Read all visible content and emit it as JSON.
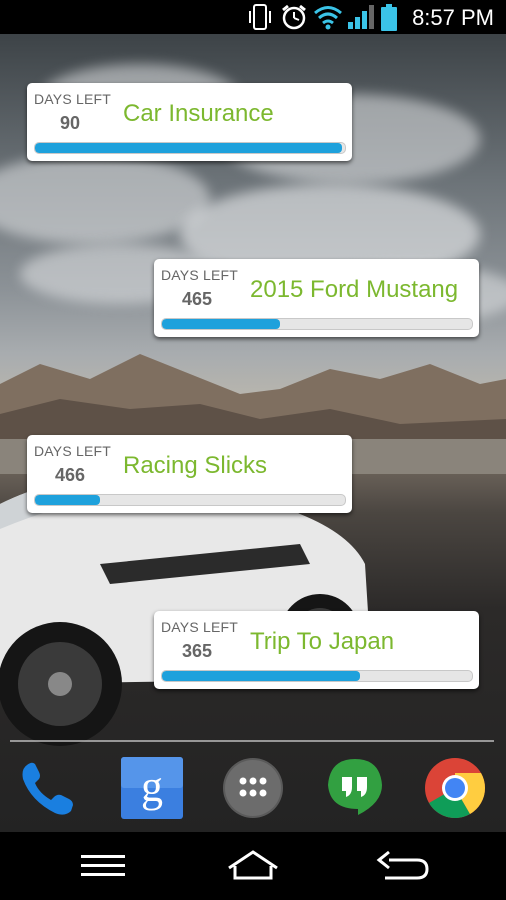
{
  "status_bar": {
    "time": "8:57 PM",
    "icons": [
      "vibrate-icon",
      "alarm-icon",
      "wifi-icon",
      "signal-icon",
      "battery-icon"
    ]
  },
  "widgets": [
    {
      "days_left_label": "DAYS LEFT",
      "days_left": "90",
      "title": "Car Insurance",
      "progress": 0.99
    },
    {
      "days_left_label": "DAYS LEFT",
      "days_left": "465",
      "title": "2015 Ford Mustang",
      "progress": 0.38
    },
    {
      "days_left_label": "DAYS LEFT",
      "days_left": "466",
      "title": "Racing Slicks",
      "progress": 0.21
    },
    {
      "days_left_label": "DAYS LEFT",
      "days_left": "365",
      "title": "Trip To Japan",
      "progress": 0.64
    }
  ],
  "dock": {
    "apps": [
      "phone-app",
      "google-search-app",
      "app-drawer",
      "hangouts-app",
      "chrome-app"
    ],
    "google_letter": "g"
  },
  "colors": {
    "accent_green": "#7cb82f",
    "progress_blue": "#1ea1dc"
  },
  "navigation": [
    "menu-button",
    "home-button",
    "back-button"
  ]
}
